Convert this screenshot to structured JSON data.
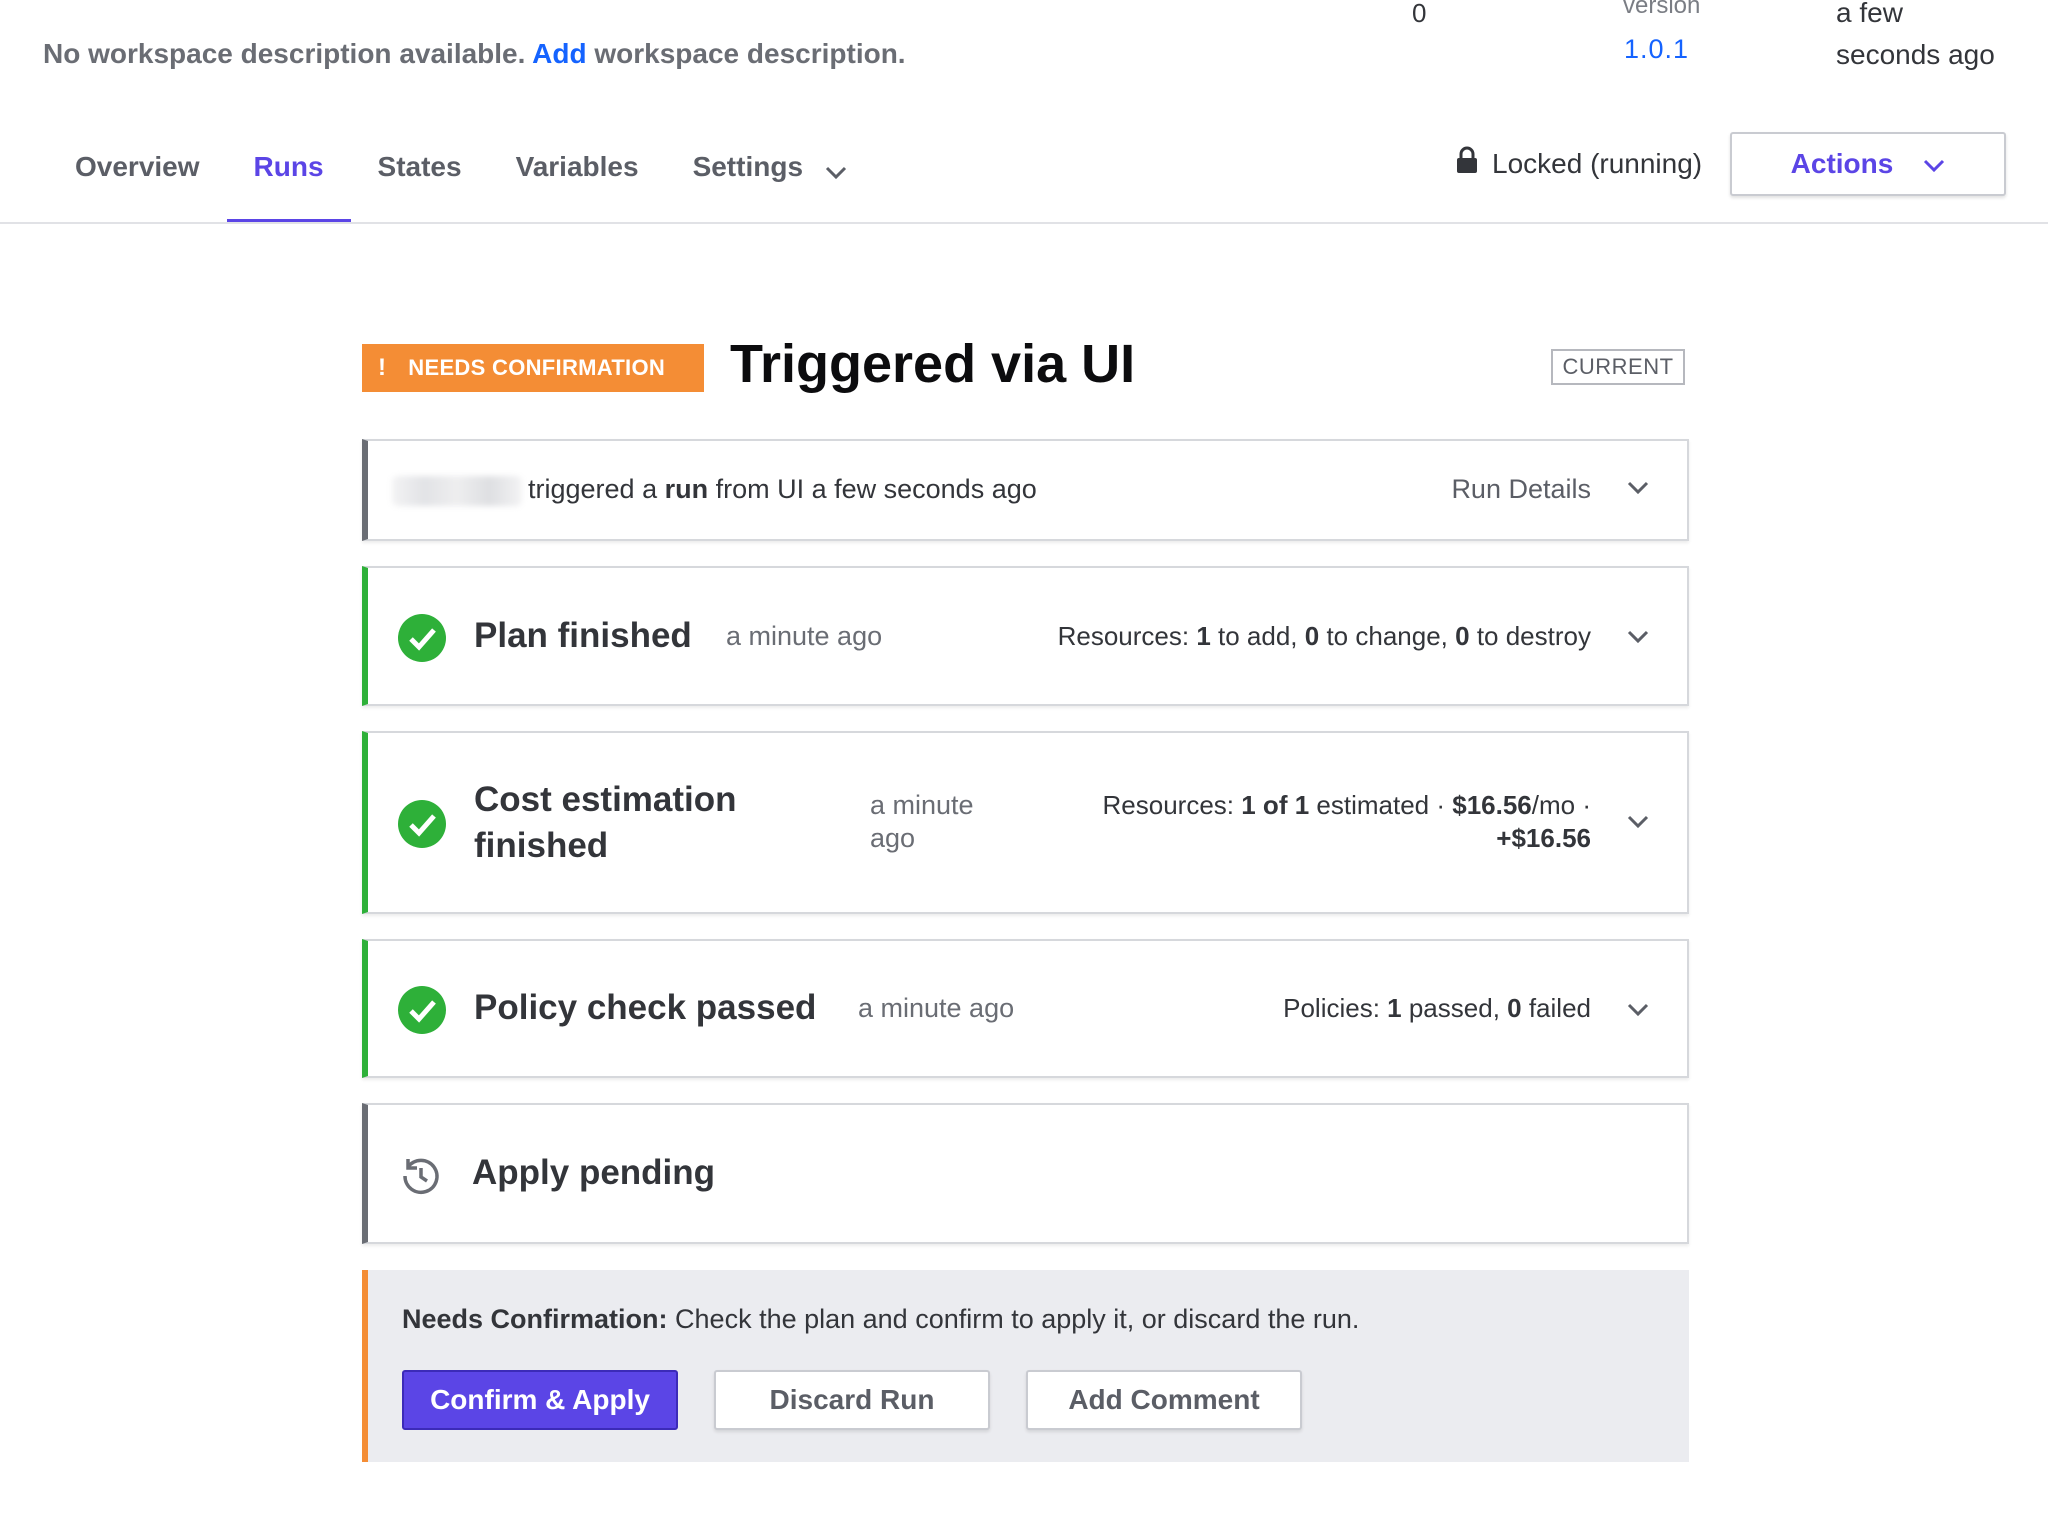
{
  "workspace": {
    "description_text": "No workspace description available.",
    "description_link": "Add",
    "description_tail": " workspace description."
  },
  "meta": {
    "count_value": "0",
    "version_label": "version",
    "version_value": "1.0.1",
    "updated_line1": "a few",
    "updated_line2": "seconds ago"
  },
  "tabs": [
    {
      "label": "Overview"
    },
    {
      "label": "Runs"
    },
    {
      "label": "States"
    },
    {
      "label": "Variables"
    },
    {
      "label": "Settings"
    }
  ],
  "lock_status": "Locked (running)",
  "actions_label": "Actions",
  "run": {
    "badge": "NEEDS CONFIRMATION",
    "badge_icon": "!",
    "title": "Triggered via UI",
    "current_label": "CURRENT",
    "trigger_pre": "triggered a ",
    "trigger_bold": "run",
    "trigger_post": " from UI a few seconds ago",
    "details_label": "Run Details"
  },
  "stages": {
    "plan": {
      "title": "Plan finished",
      "time": "a minute ago",
      "res_label": "Resources: ",
      "add": "1",
      "add_text": " to add, ",
      "change": "0",
      "change_text": " to change, ",
      "destroy": "0",
      "destroy_text": " to destroy"
    },
    "cost": {
      "title_line1": "Cost estimation",
      "title_line2": "finished",
      "time_line1": "a minute",
      "time_line2": "ago",
      "res_label": "Resources: ",
      "estimated": "1 of 1",
      "estimated_text": " estimated · ",
      "monthly": "$16.56",
      "monthly_text": "/mo ·",
      "delta": "+$16.56"
    },
    "policy": {
      "title": "Policy check passed",
      "time": "a minute ago",
      "label": "Policies: ",
      "passed": "1",
      "passed_text": " passed, ",
      "failed": "0",
      "failed_text": " failed"
    },
    "apply": {
      "title": "Apply pending"
    }
  },
  "confirmation": {
    "label": "Needs Confirmation:",
    "text": " Check the plan and confirm to apply it, or discard the run.",
    "confirm_button": "Confirm & Apply",
    "discard_button": "Discard Run",
    "comment_button": "Add Comment"
  },
  "colors": {
    "accent": "#5b45e6",
    "success": "#2eb039",
    "warning": "#f48d35",
    "link": "#1563ff"
  }
}
